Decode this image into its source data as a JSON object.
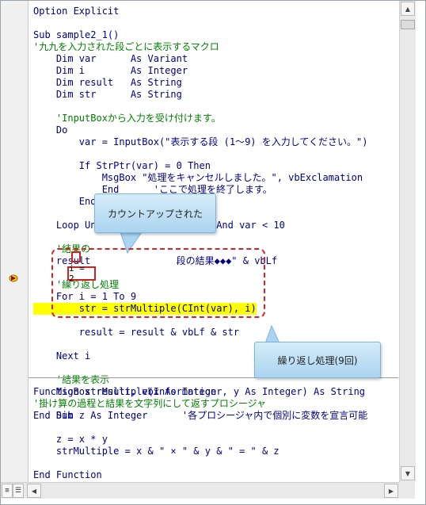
{
  "code_top": [
    {
      "text": "Option Explicit",
      "kind": "code"
    },
    {
      "text": "",
      "kind": "code"
    },
    {
      "text": "Sub sample2_1()",
      "kind": "code"
    },
    {
      "text": "'九九を入力された段ごとに表示するマクロ",
      "kind": "comment"
    },
    {
      "text": "    Dim var      As Variant",
      "kind": "code"
    },
    {
      "text": "    Dim i        As Integer",
      "kind": "code"
    },
    {
      "text": "    Dim result   As String",
      "kind": "code"
    },
    {
      "text": "    Dim str      As String",
      "kind": "code"
    },
    {
      "text": "",
      "kind": "code"
    },
    {
      "text": "    'InputBoxから入力を受け付けます。",
      "kind": "comment"
    },
    {
      "text": "    Do",
      "kind": "code"
    },
    {
      "text": "        var = InputBox(\"表示する段 (1～9) を入力してください。\")",
      "kind": "code"
    },
    {
      "text": "",
      "kind": "code"
    },
    {
      "text": "        If StrPtr(var) = 0 Then",
      "kind": "code"
    },
    {
      "text": "            MsgBox \"処理をキャンセルしました。\", vbExclamation",
      "kind": "code"
    },
    {
      "text": "            End      'ここで処理を終了します。",
      "kind": "code"
    },
    {
      "text": "        End If",
      "kind": "code"
    },
    {
      "text": "",
      "kind": "code"
    },
    {
      "text": "    Loop Until          0 < var And var < 10",
      "kind": "code"
    },
    {
      "text": "",
      "kind": "code"
    },
    {
      "text": "    '結果の",
      "kind": "comment"
    },
    {
      "text": "    result               段の結果◆◆◆\" & vbLf",
      "kind": "code"
    },
    {
      "text": "",
      "kind": "code"
    },
    {
      "text": "    '繰り返し処理",
      "kind": "comment"
    },
    {
      "text": "    For i = 1 To 9",
      "kind": "code"
    },
    {
      "text": "",
      "kind": "code"
    },
    {
      "text": "",
      "kind": "code"
    },
    {
      "text": "        result = result & vbLf & str",
      "kind": "code"
    },
    {
      "text": "",
      "kind": "code"
    },
    {
      "text": "    Next i",
      "kind": "code"
    },
    {
      "text": "",
      "kind": "code"
    },
    {
      "text": "    '結果を表示",
      "kind": "comment"
    },
    {
      "text": "    MsgBox result, vbInformation",
      "kind": "code"
    },
    {
      "text": "",
      "kind": "code"
    },
    {
      "text": "End Sub",
      "kind": "code"
    }
  ],
  "current_line": "        str = strMultiple(CInt(var), i)",
  "code_bottom": [
    {
      "text": "Function strMultiple(x As Integer, y As Integer) As String",
      "kind": "code"
    },
    {
      "text": "'掛け算の過程と結果を文字列にして返すプロシージャ",
      "kind": "comment"
    },
    {
      "text": "    Dim z As Integer      '各プロシージャ内で個別に変数を宣言可能",
      "kind": "code"
    },
    {
      "text": "",
      "kind": "code"
    },
    {
      "text": "    z = x * y",
      "kind": "code"
    },
    {
      "text": "    strMultiple = x & \" × \" & y & \" = \" & z",
      "kind": "code"
    },
    {
      "text": "",
      "kind": "code"
    },
    {
      "text": "End Function",
      "kind": "code"
    }
  ],
  "tooltip": {
    "value": "i = 2"
  },
  "callouts": {
    "counted_up": "カウントアップされた",
    "loop_process": "繰り返し処理(9回)"
  },
  "colors": {
    "keyword_text": "#000080",
    "comment_text": "#008000",
    "current_line_bg": "#ffff00",
    "callout_fill": "#aad4f0",
    "annotation_red": "#e02020"
  }
}
